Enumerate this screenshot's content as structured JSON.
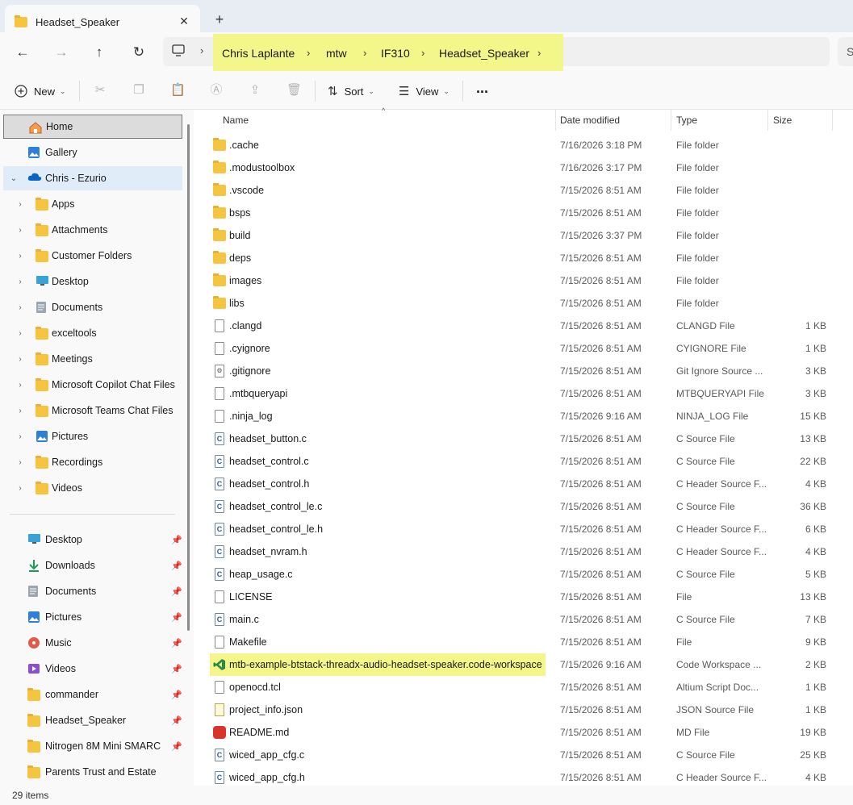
{
  "tab": {
    "title": "Headset_Speaker"
  },
  "address": {
    "crumbs": [
      "Chris Laplante",
      "mtw",
      "IF310",
      "Headset_Speaker"
    ],
    "search_partial": "S"
  },
  "toolbar": {
    "new_label": "New",
    "sort_label": "Sort",
    "view_label": "View",
    "more_label": "..."
  },
  "sidebar": {
    "items": [
      {
        "label": "Home",
        "icon": "home-icon",
        "chevron": false,
        "state": "selected"
      },
      {
        "label": "Gallery",
        "icon": "gallery-icon",
        "chevron": false
      },
      {
        "label": "Chris - Ezurio",
        "icon": "onedrive-cloud-icon",
        "chevron": "down",
        "state": "hover"
      },
      {
        "label": "Apps",
        "icon": "folder-icon",
        "chevron": "right"
      },
      {
        "label": "Attachments",
        "icon": "folder-icon",
        "chevron": "right"
      },
      {
        "label": "Customer Folders",
        "icon": "folder-icon",
        "chevron": "right"
      },
      {
        "label": "Desktop",
        "icon": "desktop-icon",
        "chevron": "right"
      },
      {
        "label": "Documents",
        "icon": "documents-icon",
        "chevron": "right"
      },
      {
        "label": "exceltools",
        "icon": "folder-icon",
        "chevron": "right"
      },
      {
        "label": "Meetings",
        "icon": "folder-icon",
        "chevron": "right"
      },
      {
        "label": "Microsoft Copilot Chat Files",
        "icon": "folder-icon",
        "chevron": "right"
      },
      {
        "label": "Microsoft Teams Chat Files",
        "icon": "folder-icon",
        "chevron": "right"
      },
      {
        "label": "Pictures",
        "icon": "pictures-icon",
        "chevron": "right"
      },
      {
        "label": "Recordings",
        "icon": "folder-icon",
        "chevron": "right"
      },
      {
        "label": "Videos",
        "icon": "folder-icon",
        "chevron": "right"
      }
    ],
    "quick_access": [
      {
        "label": "Desktop",
        "icon": "desktop-icon"
      },
      {
        "label": "Downloads",
        "icon": "downloads-icon"
      },
      {
        "label": "Documents",
        "icon": "documents-icon"
      },
      {
        "label": "Pictures",
        "icon": "pictures-icon"
      },
      {
        "label": "Music",
        "icon": "music-icon"
      },
      {
        "label": "Videos",
        "icon": "videos-icon"
      },
      {
        "label": "commander",
        "icon": "folder-icon"
      },
      {
        "label": "Headset_Speaker",
        "icon": "folder-icon"
      },
      {
        "label": "Nitrogen 8M Mini SMARC",
        "icon": "folder-icon"
      },
      {
        "label": "Parents Trust and Estate",
        "icon": "folder-icon"
      }
    ]
  },
  "columns": {
    "name": "Name",
    "date": "Date modified",
    "type": "Type",
    "size": "Size"
  },
  "files": [
    {
      "name": ".cache",
      "date": "7/16/2026 3:18 PM",
      "type": "File folder",
      "size": "",
      "icon": "folder"
    },
    {
      "name": ".modustoolbox",
      "date": "7/16/2026 3:17 PM",
      "type": "File folder",
      "size": "",
      "icon": "folder"
    },
    {
      "name": ".vscode",
      "date": "7/15/2026 8:51 AM",
      "type": "File folder",
      "size": "",
      "icon": "folder"
    },
    {
      "name": "bsps",
      "date": "7/15/2026 8:51 AM",
      "type": "File folder",
      "size": "",
      "icon": "folder"
    },
    {
      "name": "build",
      "date": "7/15/2026 3:37 PM",
      "type": "File folder",
      "size": "",
      "icon": "folder"
    },
    {
      "name": "deps",
      "date": "7/15/2026 8:51 AM",
      "type": "File folder",
      "size": "",
      "icon": "folder"
    },
    {
      "name": "images",
      "date": "7/15/2026 8:51 AM",
      "type": "File folder",
      "size": "",
      "icon": "folder"
    },
    {
      "name": "libs",
      "date": "7/15/2026 8:51 AM",
      "type": "File folder",
      "size": "",
      "icon": "folder"
    },
    {
      "name": ".clangd",
      "date": "7/15/2026 8:51 AM",
      "type": "CLANGD File",
      "size": "1 KB",
      "icon": "doc"
    },
    {
      "name": ".cyignore",
      "date": "7/15/2026 8:51 AM",
      "type": "CYIGNORE File",
      "size": "1 KB",
      "icon": "doc"
    },
    {
      "name": ".gitignore",
      "date": "7/15/2026 8:51 AM",
      "type": "Git Ignore Source ...",
      "size": "3 KB",
      "icon": "git"
    },
    {
      "name": ".mtbqueryapi",
      "date": "7/15/2026 8:51 AM",
      "type": "MTBQUERYAPI File",
      "size": "3 KB",
      "icon": "doc"
    },
    {
      "name": ".ninja_log",
      "date": "7/15/2026 9:16 AM",
      "type": "NINJA_LOG File",
      "size": "15 KB",
      "icon": "doc"
    },
    {
      "name": "headset_button.c",
      "date": "7/15/2026 8:51 AM",
      "type": "C Source File",
      "size": "13 KB",
      "icon": "c"
    },
    {
      "name": "headset_control.c",
      "date": "7/15/2026 8:51 AM",
      "type": "C Source File",
      "size": "22 KB",
      "icon": "c"
    },
    {
      "name": "headset_control.h",
      "date": "7/15/2026 8:51 AM",
      "type": "C Header Source F...",
      "size": "4 KB",
      "icon": "c"
    },
    {
      "name": "headset_control_le.c",
      "date": "7/15/2026 8:51 AM",
      "type": "C Source File",
      "size": "36 KB",
      "icon": "c"
    },
    {
      "name": "headset_control_le.h",
      "date": "7/15/2026 8:51 AM",
      "type": "C Header Source F...",
      "size": "6 KB",
      "icon": "c"
    },
    {
      "name": "headset_nvram.h",
      "date": "7/15/2026 8:51 AM",
      "type": "C Header Source F...",
      "size": "4 KB",
      "icon": "c"
    },
    {
      "name": "heap_usage.c",
      "date": "7/15/2026 8:51 AM",
      "type": "C Source File",
      "size": "5 KB",
      "icon": "c"
    },
    {
      "name": "LICENSE",
      "date": "7/15/2026 8:51 AM",
      "type": "File",
      "size": "13 KB",
      "icon": "doc"
    },
    {
      "name": "main.c",
      "date": "7/15/2026 8:51 AM",
      "type": "C Source File",
      "size": "7 KB",
      "icon": "c"
    },
    {
      "name": "Makefile",
      "date": "7/15/2026 8:51 AM",
      "type": "File",
      "size": "9 KB",
      "icon": "doc"
    },
    {
      "name": "mtb-example-btstack-threadx-audio-headset-speaker.code-workspace",
      "date": "7/15/2026 9:16 AM",
      "type": "Code Workspace ...",
      "size": "2 KB",
      "icon": "vscode",
      "highlight": true
    },
    {
      "name": "openocd.tcl",
      "date": "7/15/2026 8:51 AM",
      "type": "Altium Script Doc...",
      "size": "1 KB",
      "icon": "doc"
    },
    {
      "name": "project_info.json",
      "date": "7/15/2026 8:51 AM",
      "type": "JSON Source File",
      "size": "1 KB",
      "icon": "json"
    },
    {
      "name": "README.md",
      "date": "7/15/2026 8:51 AM",
      "type": "MD File",
      "size": "19 KB",
      "icon": "readme"
    },
    {
      "name": "wiced_app_cfg.c",
      "date": "7/15/2026 8:51 AM",
      "type": "C Source File",
      "size": "25 KB",
      "icon": "c"
    },
    {
      "name": "wiced_app_cfg.h",
      "date": "7/15/2026 8:51 AM",
      "type": "C Header Source F...",
      "size": "4 KB",
      "icon": "c"
    }
  ],
  "status": {
    "item_count": "29 items"
  },
  "colors": {
    "highlight": "#f3f78a",
    "folder": "#f5c542",
    "accent": "#0067c0"
  }
}
